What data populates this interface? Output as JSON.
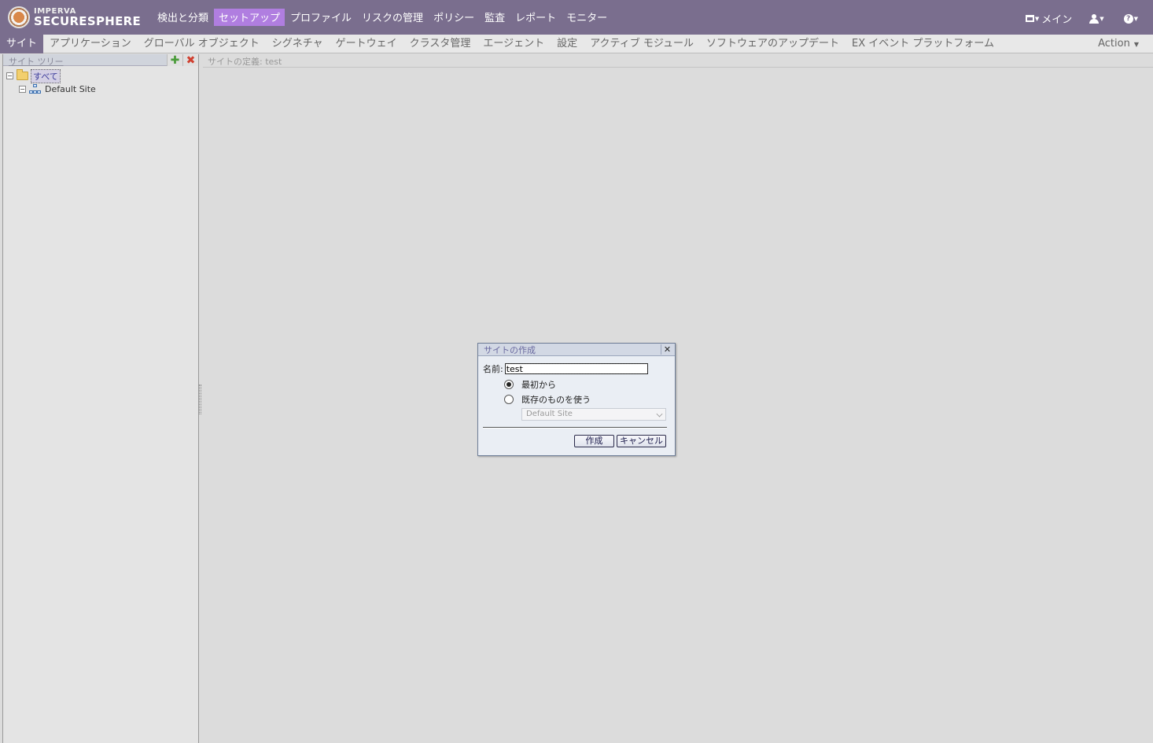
{
  "header": {
    "logo_small": "IMPERVA",
    "logo_big": "SECURESPHERE",
    "nav": [
      {
        "label": "検出と分類",
        "active": false
      },
      {
        "label": "セットアップ",
        "active": true
      },
      {
        "label": "プロファイル",
        "active": false
      },
      {
        "label": "リスクの管理",
        "active": false
      },
      {
        "label": "ポリシー",
        "active": false
      },
      {
        "label": "監査",
        "active": false
      },
      {
        "label": "レポート",
        "active": false
      },
      {
        "label": "モニター",
        "active": false
      }
    ],
    "right": {
      "main_label": "メイン"
    }
  },
  "subnav": {
    "items": [
      {
        "label": "サイト",
        "active": true
      },
      {
        "label": "アプリケーション",
        "active": false
      },
      {
        "label": "グローバル オブジェクト",
        "active": false
      },
      {
        "label": "シグネチャ",
        "active": false
      },
      {
        "label": "ゲートウェイ",
        "active": false
      },
      {
        "label": "クラスタ管理",
        "active": false
      },
      {
        "label": "エージェント",
        "active": false
      },
      {
        "label": "設定",
        "active": false
      },
      {
        "label": "アクティブ モジュール",
        "active": false
      },
      {
        "label": "ソフトウェアのアップデート",
        "active": false
      },
      {
        "label": "EX イベント プラットフォーム",
        "active": false
      }
    ],
    "action_label": "Action"
  },
  "site_tree": {
    "title": "サイト ツリー",
    "root_label": "すべて",
    "child_label": "Default Site"
  },
  "content": {
    "title": "サイトの定義: test"
  },
  "dialog": {
    "title": "サイトの作成",
    "name_label": "名前:",
    "name_value": "test",
    "option_scratch": "最初から",
    "option_existing": "既存のものを使う",
    "existing_select_value": "Default Site",
    "create_label": "作成",
    "cancel_label": "キャンセル"
  }
}
